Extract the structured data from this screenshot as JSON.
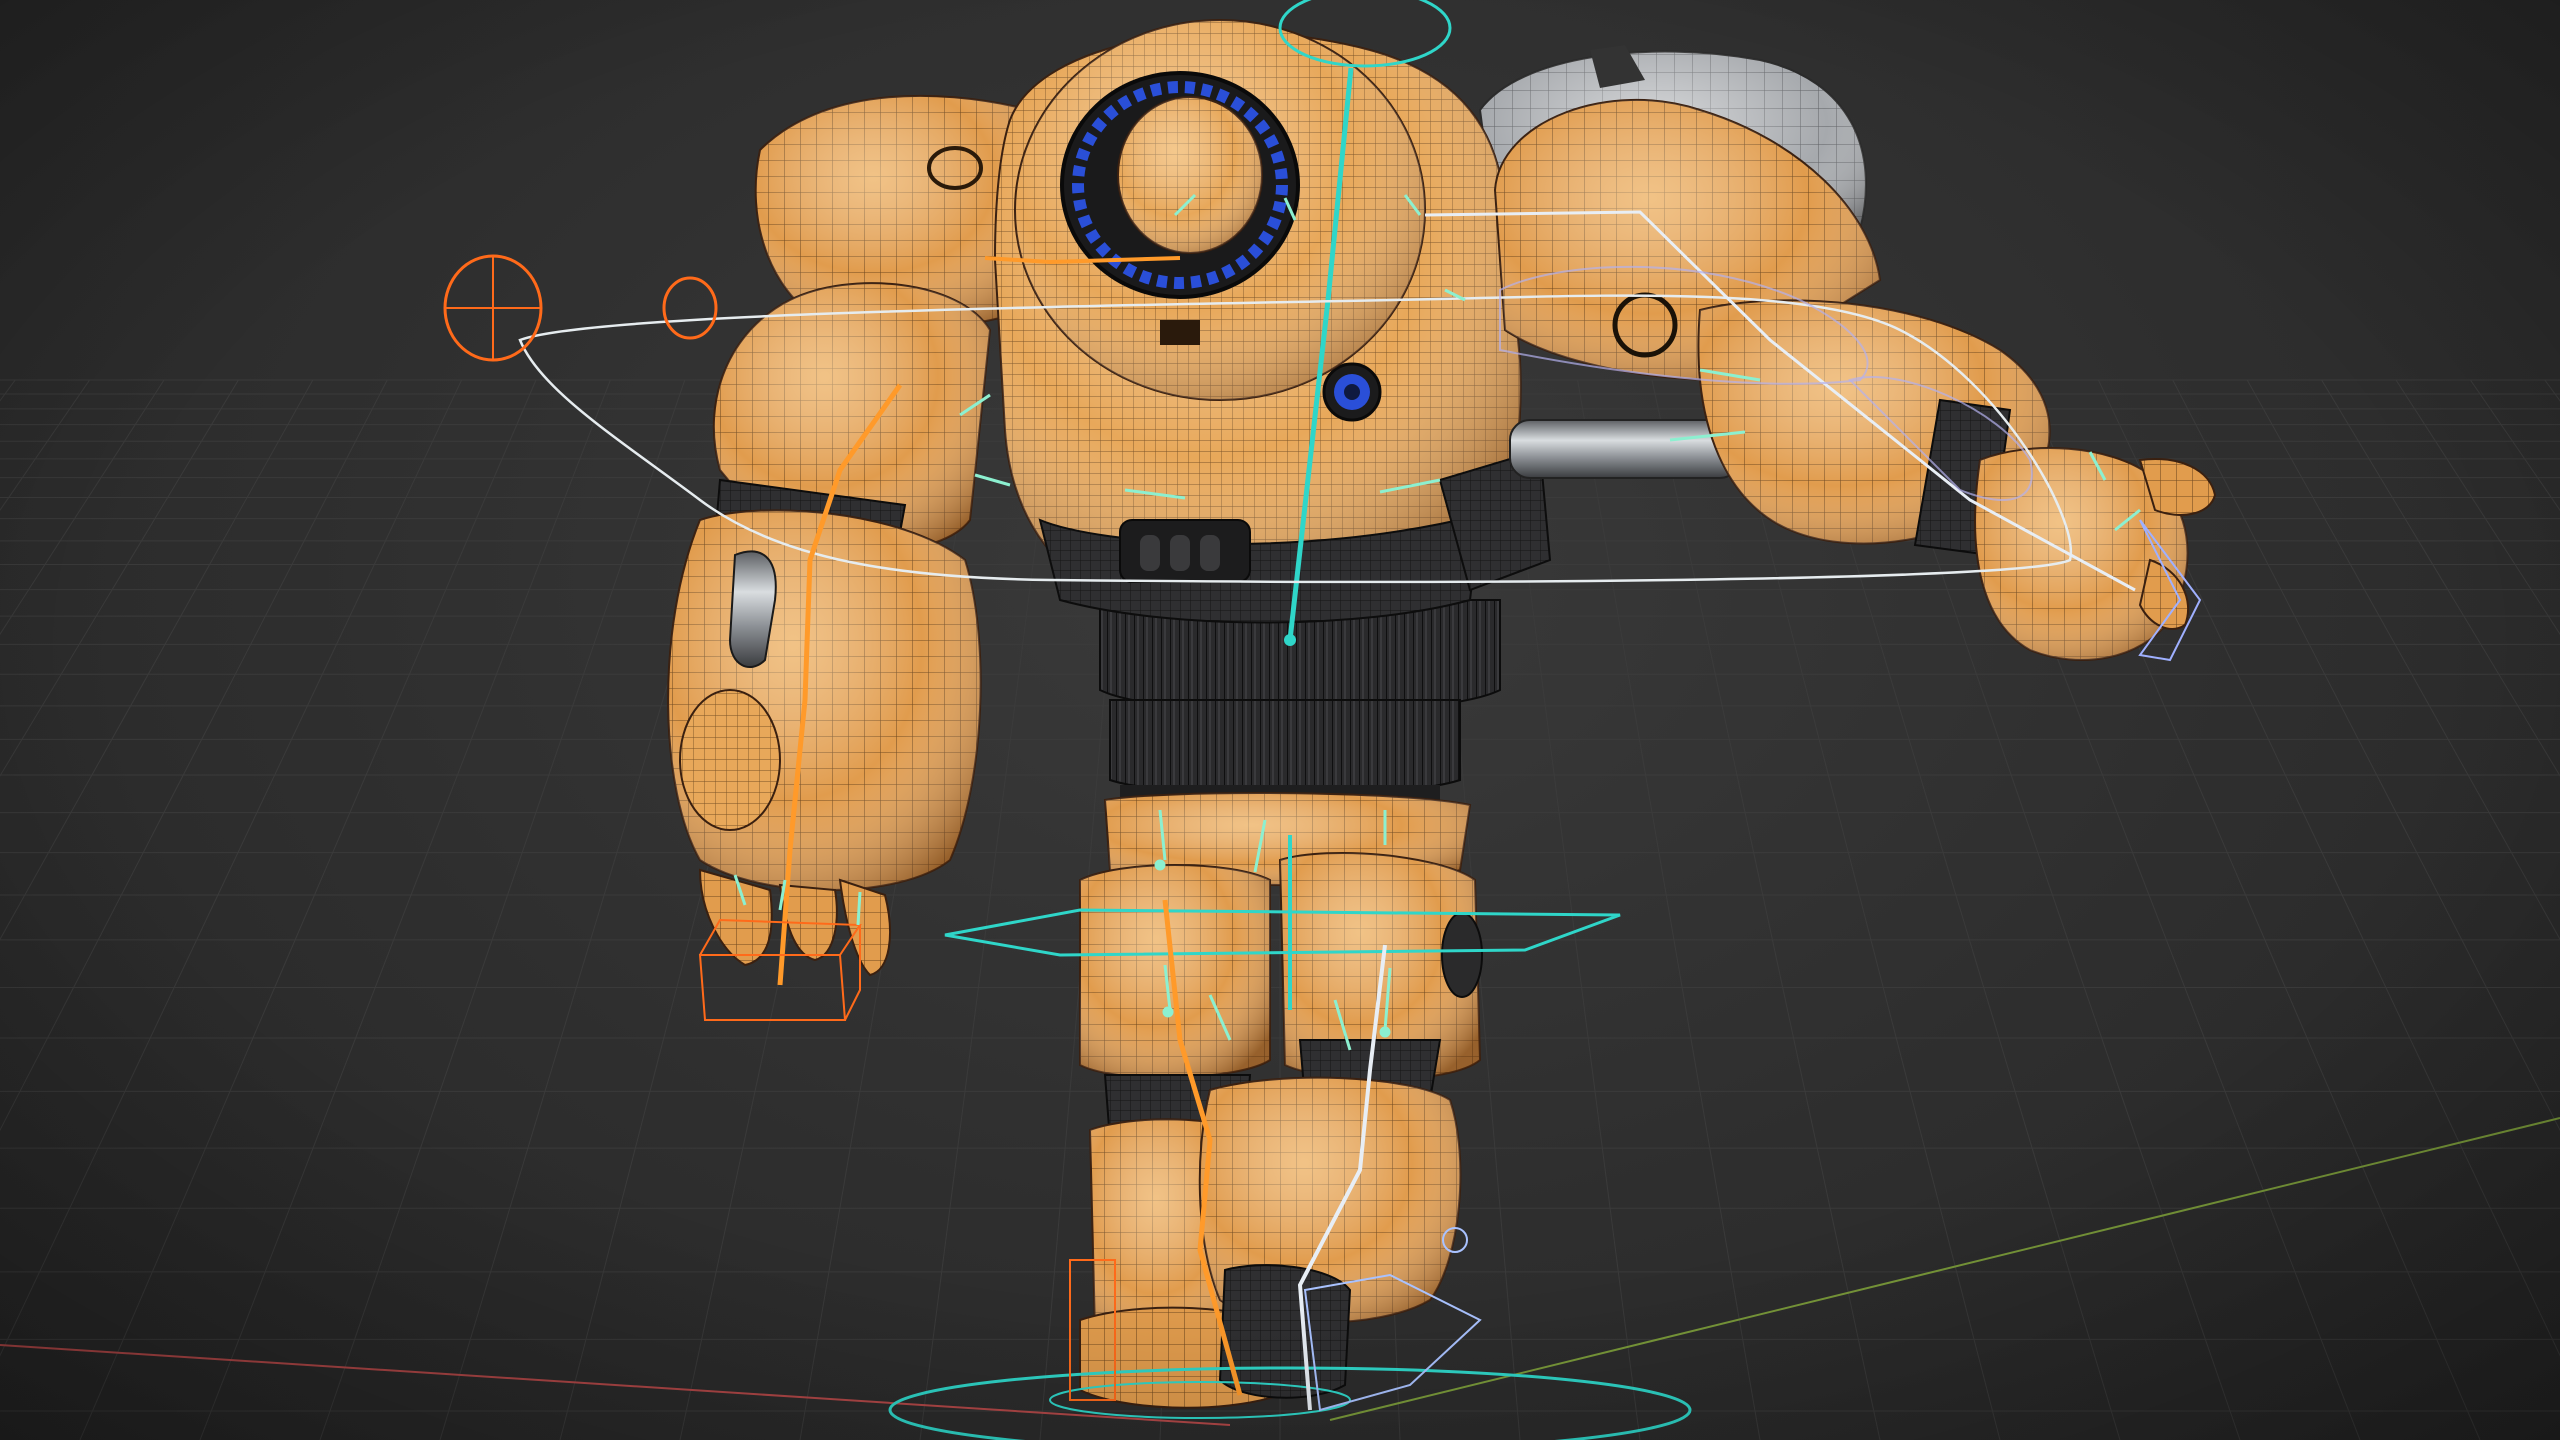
{
  "viewport": {
    "view": "3D Viewport",
    "shading": "solid-with-wireframe",
    "overlays": [
      "grid-floor",
      "x-axis-line",
      "y-axis-line",
      "armature-bones",
      "rig-controls"
    ]
  },
  "scene": {
    "model": "orange-mech-robot",
    "pose": "walking",
    "colors": {
      "background": "#2b2b2b",
      "grid": "#3c3c3c",
      "x_axis": "#b34848",
      "y_axis": "#7a9a3a",
      "body_orange": "#e5a052",
      "body_orange_dark": "#b87330",
      "body_orange_light": "#f4c489",
      "wire": "#3a2612",
      "metal_dark": "#2c2c2c",
      "metal_grey": "#8f9296",
      "accent_blue": "#2a4fd8",
      "control_cyan": "#2fd6c9",
      "control_orange": "#ff7a1a",
      "control_white": "#dfe8f0",
      "control_lavender": "#a9a6e8"
    }
  }
}
